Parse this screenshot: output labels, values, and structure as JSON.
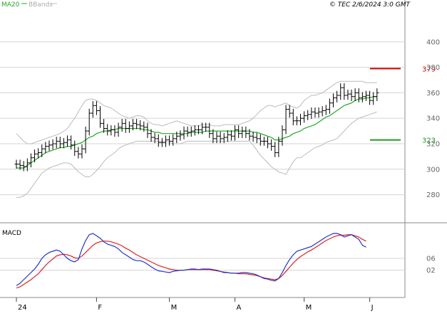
{
  "header": {
    "legend_ma20": "MA20",
    "legend_bbands": "BBands",
    "copyright": "© TEC 2/6/2024 3:0 GMT"
  },
  "macd_label": "MACD",
  "colors": {
    "price": "#000000",
    "ma20": "#22aa22",
    "bbands": "#bbbbbb",
    "macd": "#2233cc",
    "signal": "#dd2222",
    "resistance": "#cc0000",
    "support": "#229922",
    "grid": "#d4d4d4"
  },
  "chart_data": [
    {
      "type": "line",
      "name": "price",
      "ylim": [
        258,
        425
      ],
      "y_ticks": [
        "400",
        "380",
        "360",
        "340",
        "320",
        "300",
        "280"
      ],
      "x_ticks": [
        "24",
        "F",
        "M",
        "A",
        "M",
        "J"
      ],
      "levels": [
        {
          "label": "379",
          "value": 379,
          "role": "resistance"
        },
        {
          "label": "323",
          "value": 323,
          "role": "support"
        }
      ],
      "x_index_range": [
        0,
        110
      ],
      "price": [
        304,
        303,
        302,
        305,
        309,
        312,
        313,
        316,
        318,
        319,
        320,
        322,
        320,
        321,
        323,
        319,
        314,
        312,
        316,
        330,
        344,
        350,
        346,
        336,
        332,
        330,
        331,
        329,
        333,
        336,
        332,
        334,
        336,
        335,
        334,
        333,
        328,
        325,
        324,
        321,
        321,
        323,
        322,
        324,
        326,
        327,
        330,
        329,
        330,
        331,
        331,
        333,
        333,
        328,
        324,
        326,
        324,
        325,
        327,
        326,
        331,
        328,
        330,
        328,
        326,
        325,
        324,
        322,
        322,
        320,
        318,
        313,
        322,
        331,
        347,
        344,
        338,
        338,
        340,
        342,
        343,
        345,
        344,
        345,
        346,
        347,
        352,
        356,
        358,
        364,
        358,
        359,
        357,
        360,
        356,
        357,
        358,
        354,
        357,
        360
      ],
      "ma20": [
        301,
        301,
        301,
        303,
        305,
        307,
        309,
        311,
        313,
        314,
        315,
        316,
        317,
        317,
        318,
        318,
        319,
        320,
        321,
        323,
        325,
        326,
        328,
        329,
        330,
        330,
        331,
        331,
        332,
        332,
        332,
        332,
        332,
        332,
        332,
        331,
        331,
        330,
        329,
        329,
        328,
        328,
        328,
        328,
        328,
        328,
        328,
        328,
        329,
        329,
        329,
        329,
        330,
        330,
        330,
        330,
        330,
        330,
        330,
        330,
        330,
        330,
        330,
        330,
        330,
        329,
        329,
        328,
        327,
        326,
        325,
        323,
        323,
        324,
        325,
        326,
        328,
        329,
        330,
        332,
        333,
        334,
        335,
        337,
        339,
        341,
        342,
        344,
        346,
        348,
        350,
        351,
        352,
        354,
        355,
        355,
        356,
        356,
        357,
        357
      ],
      "bb_upper": [
        328,
        325,
        322,
        320,
        320,
        321,
        322,
        323,
        324,
        325,
        326,
        327,
        328,
        330,
        332,
        336,
        340,
        345,
        350,
        354,
        355,
        355,
        354,
        352,
        350,
        349,
        348,
        346,
        344,
        342,
        341,
        340,
        341,
        342,
        342,
        341,
        338,
        336,
        335,
        335,
        334,
        335,
        336,
        337,
        338,
        337,
        336,
        335,
        334,
        334,
        334,
        335,
        335,
        335,
        334,
        334,
        334,
        335,
        335,
        335,
        335,
        335,
        336,
        337,
        338,
        340,
        343,
        346,
        348,
        350,
        350,
        349,
        350,
        351,
        352,
        350,
        349,
        348,
        350,
        354,
        356,
        358,
        358,
        359,
        360,
        362,
        364,
        366,
        368,
        369,
        369,
        369,
        369,
        369,
        369,
        369,
        368,
        368,
        368,
        368
      ],
      "bb_lower": [
        278,
        278,
        279,
        281,
        285,
        289,
        293,
        297,
        299,
        301,
        302,
        303,
        304,
        305,
        305,
        304,
        301,
        298,
        296,
        294,
        294,
        296,
        299,
        302,
        306,
        309,
        311,
        313,
        316,
        318,
        319,
        320,
        321,
        322,
        322,
        322,
        322,
        322,
        322,
        322,
        322,
        322,
        321,
        320,
        320,
        320,
        321,
        322,
        322,
        322,
        322,
        322,
        322,
        322,
        322,
        322,
        322,
        322,
        322,
        322,
        322,
        322,
        322,
        322,
        322,
        319,
        315,
        311,
        308,
        305,
        302,
        300,
        298,
        297,
        296,
        301,
        306,
        309,
        309,
        311,
        313,
        315,
        317,
        318,
        319,
        321,
        322,
        323,
        324,
        327,
        330,
        333,
        336,
        338,
        340,
        341,
        342,
        343,
        344,
        345
      ],
      "macd_ylim": [
        -0.2,
        1.0
      ],
      "macd_ticks": [
        "06",
        "02"
      ],
      "macd_tick_values": [
        0.46,
        0.26
      ],
      "macd": [
        0.0,
        0.04,
        0.1,
        0.16,
        0.22,
        0.28,
        0.36,
        0.46,
        0.52,
        0.56,
        0.58,
        0.6,
        0.58,
        0.52,
        0.46,
        0.42,
        0.4,
        0.44,
        0.62,
        0.76,
        0.86,
        0.88,
        0.84,
        0.8,
        0.74,
        0.7,
        0.68,
        0.66,
        0.62,
        0.56,
        0.52,
        0.48,
        0.44,
        0.42,
        0.42,
        0.4,
        0.36,
        0.32,
        0.28,
        0.25,
        0.24,
        0.23,
        0.22,
        0.24,
        0.25,
        0.26,
        0.26,
        0.27,
        0.28,
        0.28,
        0.27,
        0.28,
        0.28,
        0.28,
        0.27,
        0.26,
        0.24,
        0.22,
        0.22,
        0.21,
        0.21,
        0.21,
        0.22,
        0.22,
        0.21,
        0.2,
        0.18,
        0.15,
        0.12,
        0.11,
        0.09,
        0.08,
        0.12,
        0.22,
        0.34,
        0.44,
        0.52,
        0.58,
        0.6,
        0.62,
        0.64,
        0.66,
        0.7,
        0.74,
        0.78,
        0.82,
        0.85,
        0.88,
        0.88,
        0.86,
        0.82,
        0.84,
        0.86,
        0.82,
        0.78,
        0.68,
        0.65
      ],
      "signal": [
        -0.04,
        -0.02,
        0.02,
        0.06,
        0.1,
        0.15,
        0.2,
        0.27,
        0.34,
        0.4,
        0.45,
        0.5,
        0.52,
        0.53,
        0.52,
        0.5,
        0.47,
        0.46,
        0.5,
        0.56,
        0.62,
        0.68,
        0.72,
        0.74,
        0.75,
        0.75,
        0.74,
        0.72,
        0.7,
        0.67,
        0.63,
        0.6,
        0.56,
        0.52,
        0.49,
        0.46,
        0.43,
        0.4,
        0.37,
        0.34,
        0.32,
        0.3,
        0.28,
        0.27,
        0.26,
        0.26,
        0.26,
        0.27,
        0.27,
        0.27,
        0.27,
        0.27,
        0.27,
        0.27,
        0.26,
        0.25,
        0.24,
        0.23,
        0.22,
        0.21,
        0.21,
        0.2,
        0.2,
        0.2,
        0.19,
        0.18,
        0.17,
        0.15,
        0.13,
        0.12,
        0.11,
        0.1,
        0.12,
        0.17,
        0.24,
        0.31,
        0.38,
        0.44,
        0.49,
        0.53,
        0.57,
        0.6,
        0.64,
        0.68,
        0.72,
        0.76,
        0.79,
        0.82,
        0.84,
        0.85,
        0.85,
        0.86,
        0.86,
        0.84,
        0.82,
        0.78,
        0.75
      ]
    }
  ]
}
